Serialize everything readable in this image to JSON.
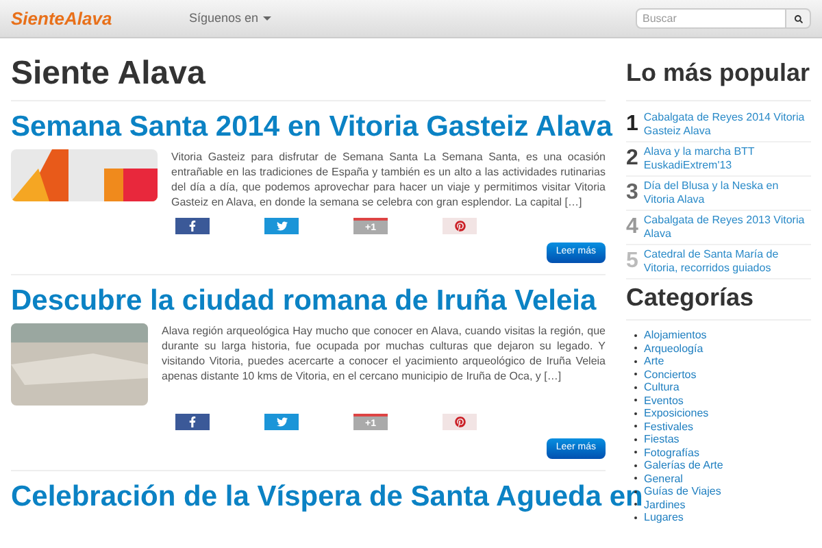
{
  "navbar": {
    "logo": "SienteAlava",
    "menu": "Síguenos en",
    "search": {
      "placeholder": "Buscar"
    }
  },
  "page_title": "Siente Alava",
  "posts": [
    {
      "title": "Semana Santa 2014 en Vitoria Gasteiz Alava",
      "excerpt": "Vitoria Gasteiz para disfrutar de Semana Santa La Semana Santa, es una ocasión entrañable en las tradiciones de España y también es un alto a las actividades rutinarias del día a día, que podemos aprovechar para hacer un viaje y permitimos visitar Vitoria Gasteiz en Alava, en donde la semana se celebra con gran esplendor. La capital […]",
      "share": [
        {
          "kind": "facebook"
        },
        {
          "kind": "twitter"
        },
        {
          "kind": "google",
          "label": "+1"
        },
        {
          "kind": "pinterest"
        }
      ],
      "button": "Leer más"
    },
    {
      "title": "Descubre la ciudad romana de Iruña Veleia",
      "excerpt": "Alava región arqueológica Hay mucho que conocer en Alava, cuando visitas la región, que durante su larga historia, fue ocupada por muchas culturas que dejaron su legado. Y visitando Vitoria, puedes acercarte a conocer el yacimiento arqueológico de Iruña Veleia  apenas distante 10 kms de Vitoria, en el cercano municipio de Iruña de Oca, y […]",
      "share": [
        {
          "kind": "facebook"
        },
        {
          "kind": "twitter"
        },
        {
          "kind": "google",
          "label": "+1"
        },
        {
          "kind": "pinterest"
        }
      ],
      "button": "Leer más"
    },
    {
      "title": "Celebración de la Víspera de Santa Agueda en"
    }
  ],
  "sidebar": {
    "popular_title": "Lo más popular",
    "popular": [
      {
        "rank": "1",
        "title": "Cabalgata de Reyes 2014 Vitoria Gasteiz Alava"
      },
      {
        "rank": "2",
        "title": "Alava y la marcha BTT EuskadiExtrem'13"
      },
      {
        "rank": "3",
        "title": "Día del Blusa y la Neska en Vitoria Alava"
      },
      {
        "rank": "4",
        "title": "Cabalgata de Reyes 2013 Vitoria Alava"
      },
      {
        "rank": "5",
        "title": "Catedral de Santa María de Vitoria, recorridos guiados"
      }
    ],
    "categories_title": "Categorías",
    "categories": [
      "Alojamientos",
      "Arqueología",
      "Arte",
      "Conciertos",
      "Cultura",
      "Eventos",
      "Exposiciones",
      "Festivales",
      "Fiestas",
      "Fotografías",
      "Galerías de Arte",
      "General",
      "Guías de Viajes",
      "Jardines",
      "Lugares"
    ]
  }
}
